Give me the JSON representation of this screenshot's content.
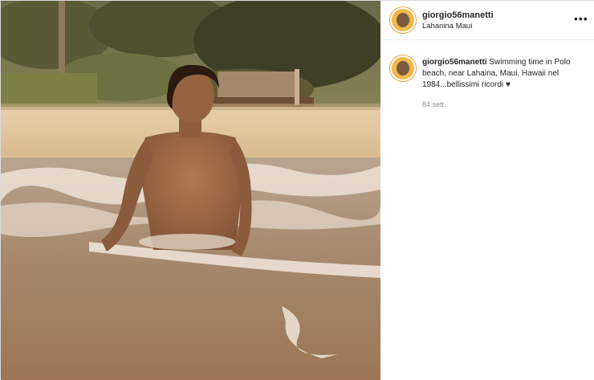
{
  "post": {
    "username": "giorgio56manetti",
    "location": "Lahanina Maui",
    "caption_text": "Swimming time in Polo beach, near Lahaina, Maui, Hawaii nel 1984...bellissimi ricordi",
    "caption_heart": "♥",
    "timestamp": "84 sett."
  },
  "icons": {
    "more": "more-options-icon"
  },
  "colors": {
    "photo_sepia": "#b58f6b",
    "text_primary": "#262626",
    "text_secondary": "#8e8e8e"
  }
}
